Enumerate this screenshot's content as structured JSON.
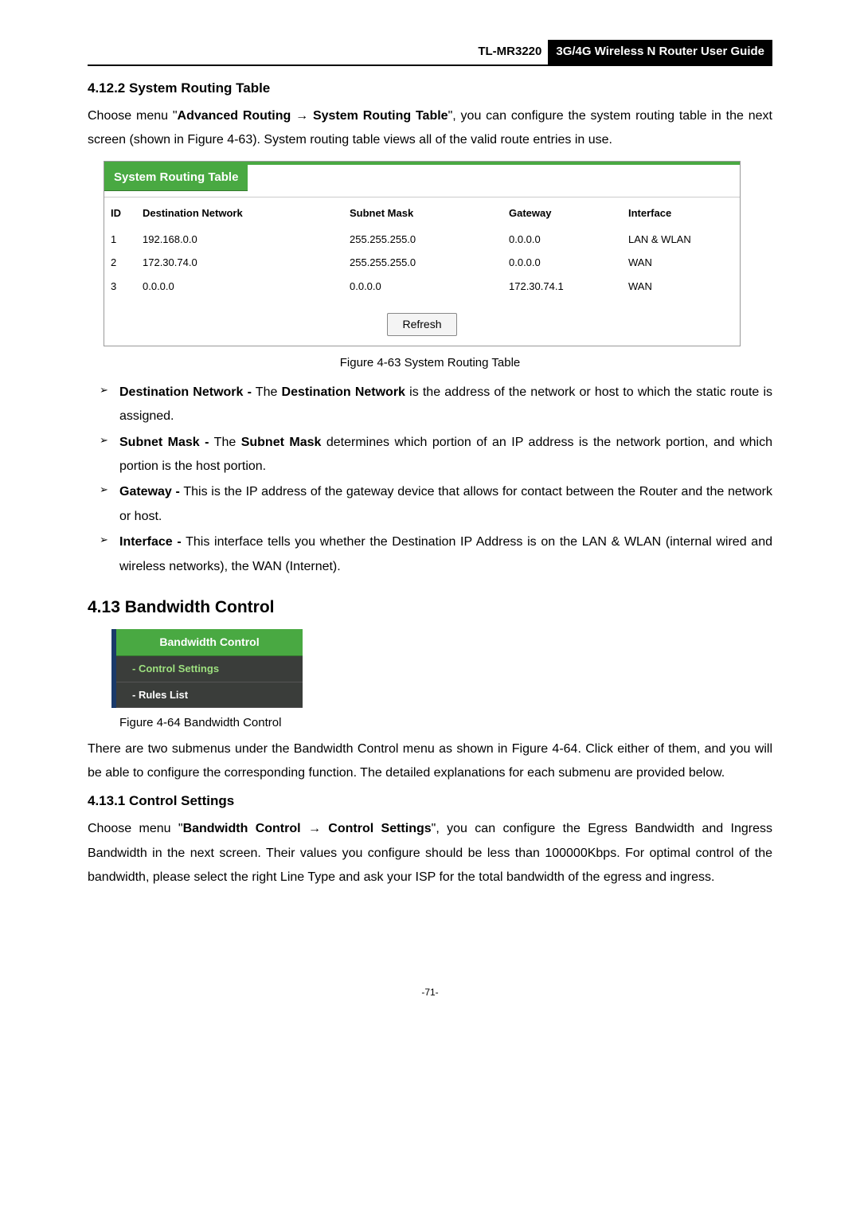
{
  "header": {
    "model": "TL-MR3220",
    "title": "3G/4G Wireless N Router User Guide"
  },
  "section_4_12_2": {
    "heading": "4.12.2   System Routing Table",
    "intro_pre": "Choose menu \"",
    "intro_bold1": "Advanced Routing",
    "intro_arrow": " → ",
    "intro_bold2": "System Routing Table",
    "intro_post": "\", you can configure the system routing table in the next screen (shown in Figure 4-63). System routing table views all of the valid route entries in use."
  },
  "routing_panel": {
    "title": "System Routing Table",
    "headers": {
      "id": "ID",
      "dest": "Destination Network",
      "mask": "Subnet Mask",
      "gateway": "Gateway",
      "iface": "Interface"
    },
    "rows": [
      {
        "id": "1",
        "dest": "192.168.0.0",
        "mask": "255.255.255.0",
        "gateway": "0.0.0.0",
        "iface": "LAN & WLAN"
      },
      {
        "id": "2",
        "dest": "172.30.74.0",
        "mask": "255.255.255.0",
        "gateway": "0.0.0.0",
        "iface": "WAN"
      },
      {
        "id": "3",
        "dest": "0.0.0.0",
        "mask": "0.0.0.0",
        "gateway": "172.30.74.1",
        "iface": "WAN"
      }
    ],
    "refresh": "Refresh"
  },
  "figure_4_63": "Figure 4-63    System Routing Table",
  "bullets": [
    {
      "b1": "Destination Network -",
      "t1": " The ",
      "b2": "Destination Network",
      "t2": " is the address of the network or host to which the static route is assigned."
    },
    {
      "b1": "Subnet Mask -",
      "t1": " The ",
      "b2": "Subnet Mask",
      "t2": " determines which portion of an IP address is the network portion, and which portion is the host portion."
    },
    {
      "b1": "Gateway -",
      "t1": " This is the IP address of the gateway device that allows for contact between the Router and the network or host.",
      "b2": "",
      "t2": ""
    },
    {
      "b1": "Interface -",
      "t1": " This interface tells you whether the Destination IP Address is on the LAN & WLAN (internal wired and wireless networks), the WAN (Internet).",
      "b2": "",
      "t2": ""
    }
  ],
  "section_4_13": {
    "heading": "4.13 Bandwidth Control",
    "menu": {
      "title": "Bandwidth Control",
      "item1": "- Control Settings",
      "item2": "- Rules List"
    },
    "figure": "Figure 4-64 Bandwidth Control",
    "body": "There are two submenus under the Bandwidth Control menu as shown in Figure 4-64. Click either of them, and you will be able to configure the corresponding function. The detailed explanations for each submenu are provided below."
  },
  "section_4_13_1": {
    "heading": "4.13.1   Control Settings",
    "pre": "Choose menu \"",
    "b1": "Bandwidth Control",
    "arrow": " → ",
    "b2": "Control Settings",
    "post": "\", you can configure the Egress Bandwidth and Ingress Bandwidth in the next screen. Their values you configure should be less than 100000Kbps. For optimal control of the bandwidth, please select the right Line Type and ask your ISP for the total bandwidth of the egress and ingress."
  },
  "page_num": "-71-"
}
